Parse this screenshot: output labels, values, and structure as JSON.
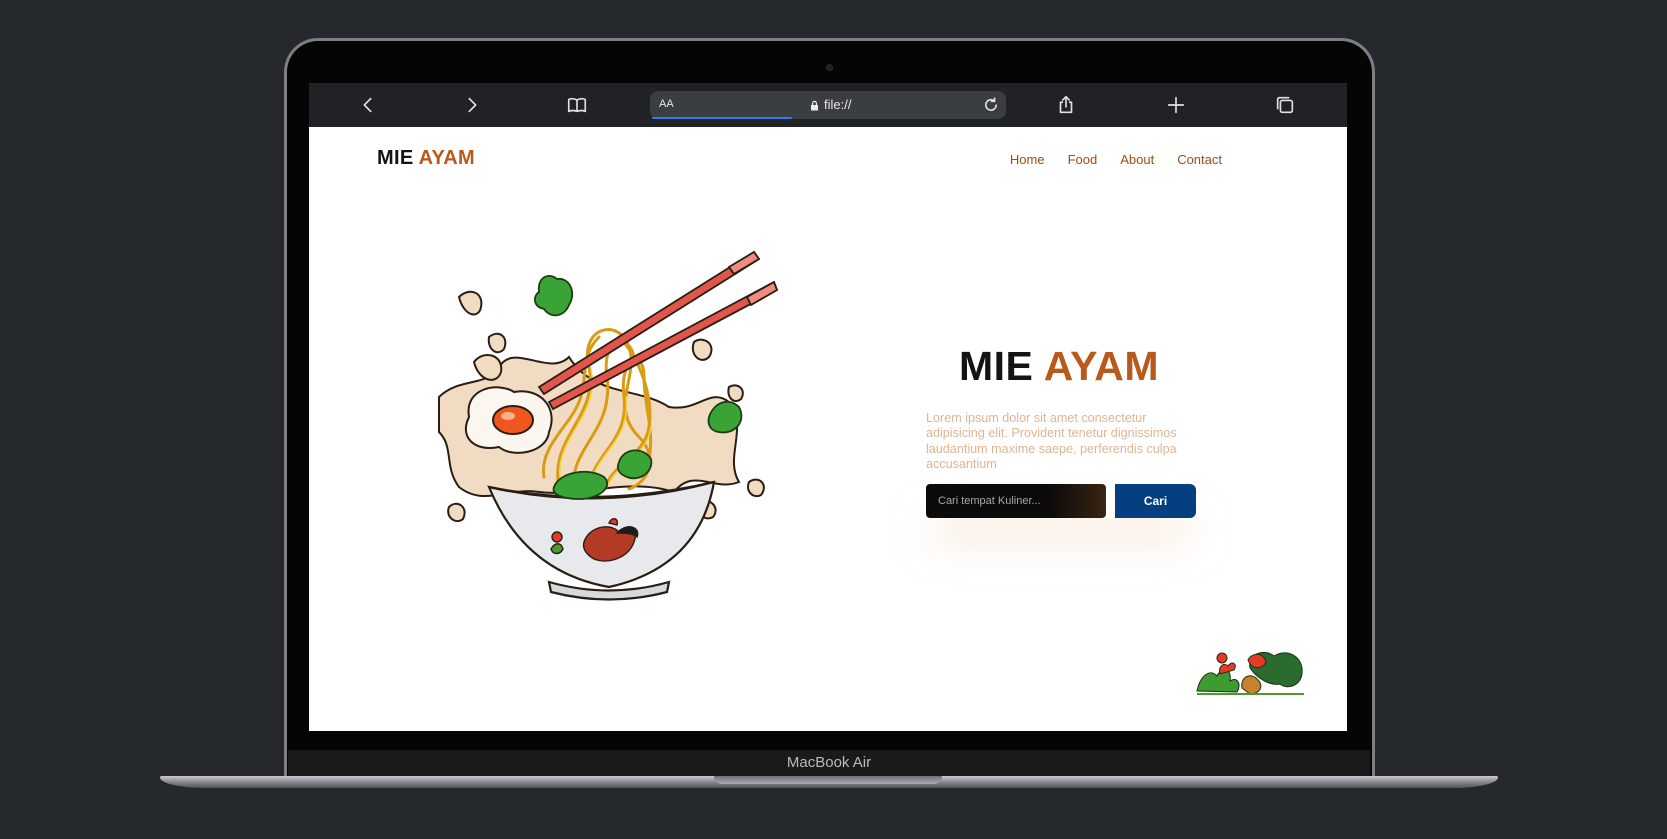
{
  "device": {
    "model_label": "MacBook Air"
  },
  "browser": {
    "text_size_label": "AA",
    "url": "file://",
    "icons": [
      "back-icon",
      "forward-icon",
      "bookmarks-icon",
      "lock-icon",
      "reload-icon",
      "share-icon",
      "new-tab-icon",
      "tabs-icon"
    ],
    "load_progress": 0.4
  },
  "site": {
    "logo": {
      "dark": "MIE",
      "accent": "AYAM"
    },
    "nav": [
      "Home",
      "Food",
      "About",
      "Contact"
    ],
    "hero": {
      "title_dark": "MIE",
      "title_accent": "AYAM",
      "description": "Lorem ipsum dolor sit amet consectetur adipisicing elit. Provident tenetur dignissimos laudantium maxime saepe, perferendis culpa accusantium",
      "search_placeholder": "Cari tempat Kuliner...",
      "search_button": "Cari"
    },
    "images": [
      "chicken-noodle-bowl-illustration",
      "rooster-decoration"
    ]
  },
  "colors": {
    "accent": "#b85a1c",
    "nav": "#a14d10",
    "description": "#deb593",
    "button": "#053f80",
    "desktop_background": "#25292d"
  }
}
